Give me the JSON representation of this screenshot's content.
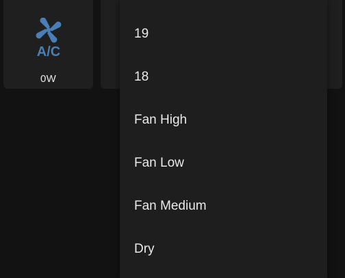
{
  "tile": {
    "icon": "ac-fan-icon",
    "icon_text": "A/C",
    "power": "0W",
    "icon_color": "#4a7fb5"
  },
  "menu": {
    "items": [
      {
        "label": "19"
      },
      {
        "label": "18"
      },
      {
        "label": "Fan High"
      },
      {
        "label": "Fan Low"
      },
      {
        "label": "Fan Medium"
      },
      {
        "label": "Dry"
      }
    ]
  }
}
